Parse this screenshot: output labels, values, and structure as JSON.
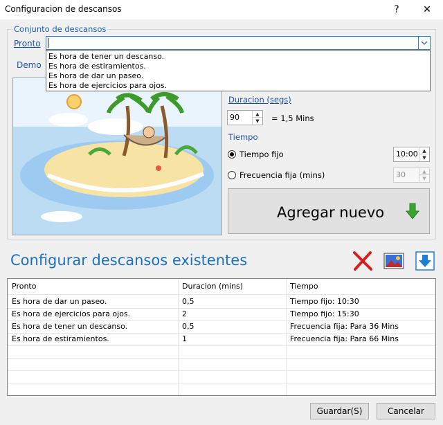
{
  "window": {
    "title": "Configuracion de descansos",
    "help": "?",
    "close": "✕"
  },
  "group": {
    "legend": "Conjunto de descansos",
    "pronto_label": "Pronto",
    "demo_label": "Demo"
  },
  "combo": {
    "value": "",
    "options": [
      "Es hora de tener un descanso.",
      "Es hora de estiramientos.",
      "Es hora de dar un paseo.",
      "Es hora de ejercicios para ojos."
    ]
  },
  "duration": {
    "label": "Duracion (segs)",
    "value": "90",
    "equals": "= 1,5 Mins"
  },
  "tiempo": {
    "label": "Tiempo",
    "fixed_label": "Tiempo fijo",
    "fixed_value": "10:00",
    "freq_label": "Frecuencia fija (mins)",
    "freq_value": "30",
    "selected": "fixed"
  },
  "add_button": {
    "label": "Agregar nuevo"
  },
  "existing": {
    "title": "Configurar descansos existentes",
    "columns": [
      "Pronto",
      "Duracion (mins)",
      "Tiempo"
    ],
    "rows": [
      [
        "Es hora de dar un paseo.",
        "0,5",
        "Tiempo fijo: 10:30"
      ],
      [
        "Es hora de ejercicios para ojos.",
        "2",
        "Tiempo fijo: 15:30"
      ],
      [
        "Es hora de tener un descanso.",
        "0,5",
        "Frecuencia fija: Para 36 Mins"
      ],
      [
        "Es hora de estiramientos.",
        "1",
        "Frecuencia fija: Para 66 Mins"
      ]
    ]
  },
  "footer": {
    "save": "Guardar(S)",
    "cancel": "Cancelar"
  },
  "colors": {
    "accent": "#1e6fc0",
    "link": "#1a4fb0",
    "delete": "#d42020",
    "arrow_green": "#3aa42e",
    "down_blue": "#1e7fd6"
  }
}
